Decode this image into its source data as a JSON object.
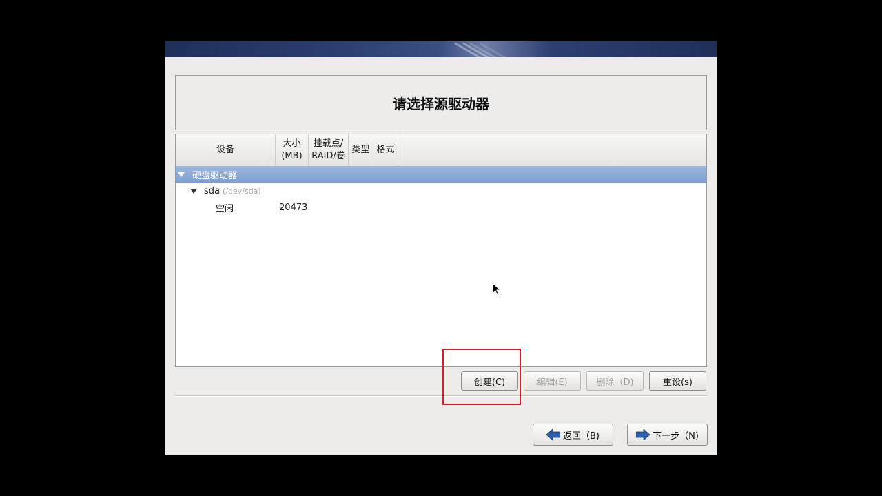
{
  "page": {
    "title": "请选择源驱动器"
  },
  "table": {
    "columns": [
      "设备",
      "大小\n(MB)",
      "挂载点/\nRAID/卷",
      "类型",
      "格式"
    ],
    "group": {
      "label": "硬盘驱动器"
    },
    "disk": {
      "name": "sda",
      "path": "(/dev/sda)"
    },
    "free": {
      "label": "空闲",
      "size": "20473"
    }
  },
  "partition_buttons": {
    "create": "创建(C)",
    "edit": "编辑(E)",
    "delete": "删除（D)",
    "reset": "重设(s)"
  },
  "nav_buttons": {
    "back": "返回（B)",
    "next": "下一步（N)"
  },
  "colors": {
    "selection": "#8aaad6",
    "highlight": "#e01b24",
    "arrow": "#2f5fa8"
  }
}
